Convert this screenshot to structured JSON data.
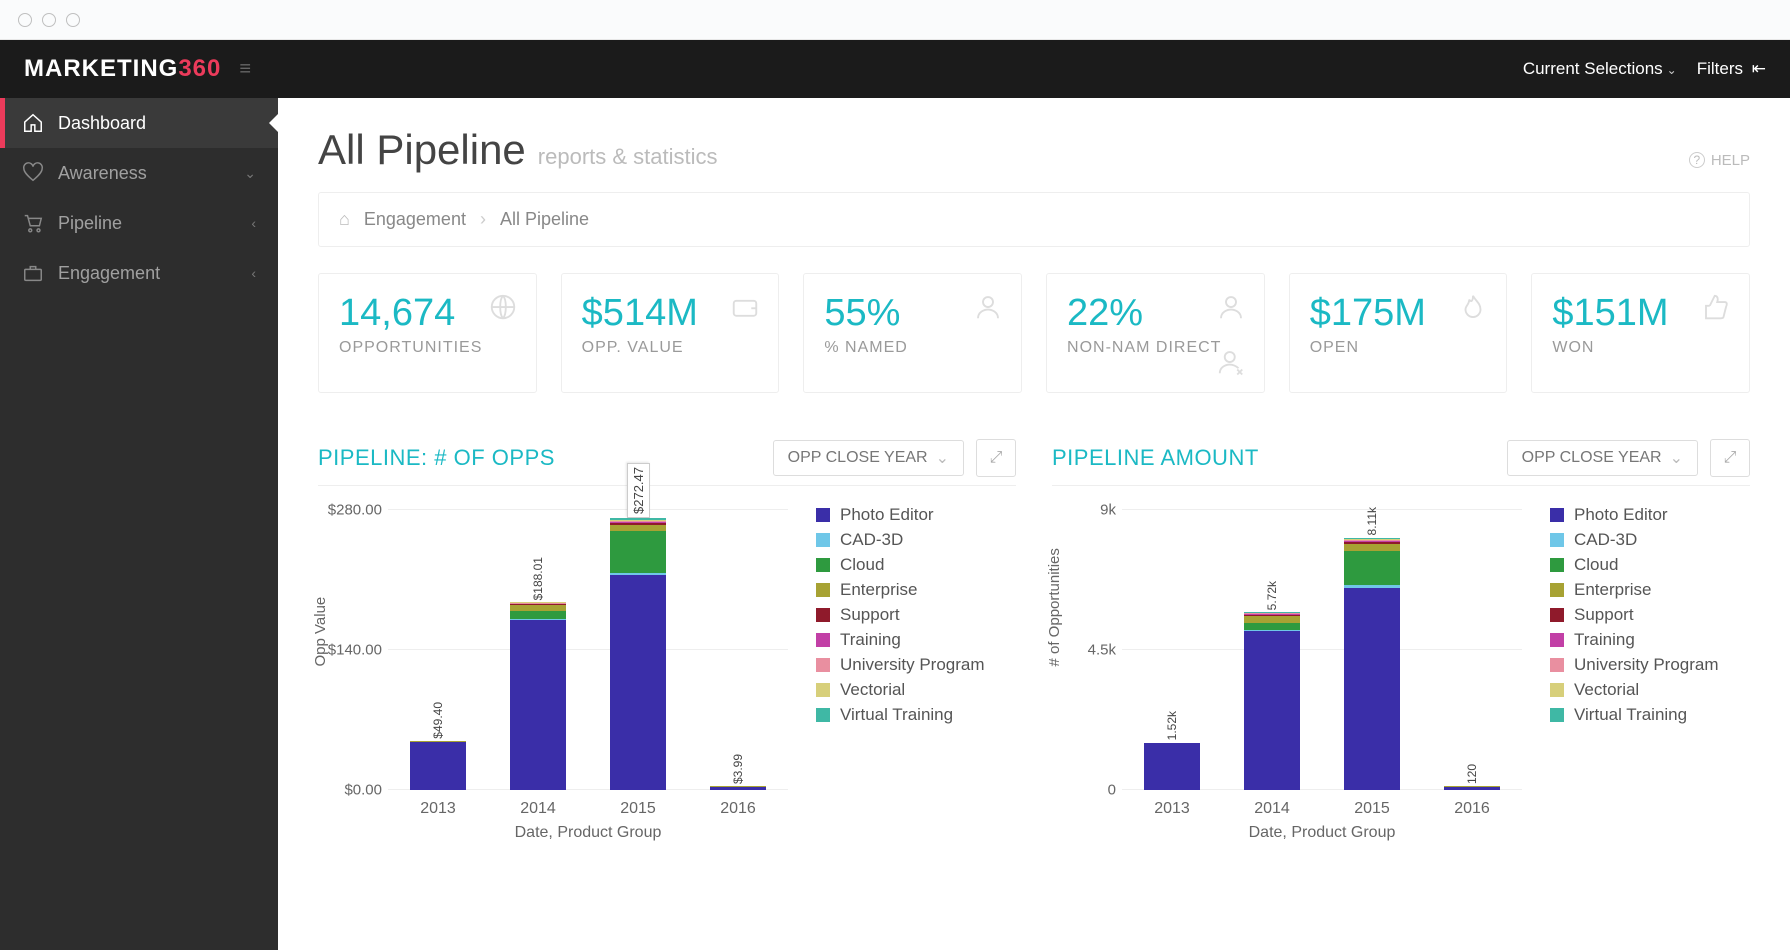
{
  "brand": {
    "part1": "MARKETING",
    "part2": "360"
  },
  "topbar": {
    "selections": "Current Selections",
    "filters": "Filters"
  },
  "sidebar": {
    "items": [
      {
        "label": "Dashboard",
        "icon": "home",
        "active": true
      },
      {
        "label": "Awareness",
        "icon": "heart",
        "expand": "down"
      },
      {
        "label": "Pipeline",
        "icon": "cart",
        "expand": "left"
      },
      {
        "label": "Engagement",
        "icon": "briefcase",
        "expand": "left"
      }
    ]
  },
  "page": {
    "title": "All Pipeline",
    "subtitle": "reports & statistics",
    "help": "HELP"
  },
  "breadcrumb": {
    "root": "Engagement",
    "leaf": "All Pipeline"
  },
  "kpi": [
    {
      "value": "14,674",
      "label": "OPPORTUNITIES",
      "icon": "globe"
    },
    {
      "value": "$514M",
      "label": "OPP. VALUE",
      "icon": "wallet"
    },
    {
      "value": "55%",
      "label": "% NAMED",
      "icon": "person"
    },
    {
      "value": "22%",
      "label": "NON-NAM DIRECT",
      "icon": "person-x"
    },
    {
      "value": "$175M",
      "label": "OPEN",
      "icon": "flame"
    },
    {
      "value": "$151M",
      "label": "WON",
      "icon": "thumb"
    }
  ],
  "dropdowns": {
    "closeYear": "OPP CLOSE YEAR"
  },
  "legend": [
    {
      "name": "Photo Editor",
      "color": "#3a2ea8"
    },
    {
      "name": "CAD-3D",
      "color": "#6fc7e8"
    },
    {
      "name": "Cloud",
      "color": "#2e9a3f"
    },
    {
      "name": "Enterprise",
      "color": "#a7a233"
    },
    {
      "name": "Support",
      "color": "#8f1a2b"
    },
    {
      "name": "Training",
      "color": "#c23fa6"
    },
    {
      "name": "University Program",
      "color": "#e98fa0"
    },
    {
      "name": "Vectorial",
      "color": "#d7cf7a"
    },
    {
      "name": "Virtual Training",
      "color": "#3fb8a5"
    }
  ],
  "chart_data": [
    {
      "type": "bar",
      "title": "PIPELINE: # OF OPPS",
      "ylabel": "Opp Value",
      "xlabel": "Date, Product Group",
      "y_ticks": [
        "$0.00",
        "$140.00",
        "$280.00"
      ],
      "ylim": [
        0,
        280
      ],
      "categories": [
        "2013",
        "2014",
        "2015",
        "2016"
      ],
      "totals": [
        49.4,
        188.01,
        272.47,
        3.99
      ],
      "total_labels": [
        "$49.40",
        "$188.01",
        "$272.47",
        "$3.99"
      ],
      "series": [
        {
          "name": "Photo Editor",
          "values": [
            48,
            170,
            215,
            3
          ]
        },
        {
          "name": "CAD-3D",
          "values": [
            0,
            1,
            2,
            0
          ]
        },
        {
          "name": "Cloud",
          "values": [
            0,
            8,
            42,
            0.5
          ]
        },
        {
          "name": "Enterprise",
          "values": [
            1,
            6,
            6,
            0.3
          ]
        },
        {
          "name": "Support",
          "values": [
            0,
            1,
            2,
            0
          ]
        },
        {
          "name": "Training",
          "values": [
            0,
            0.5,
            1,
            0
          ]
        },
        {
          "name": "University Program",
          "values": [
            0,
            0.5,
            1,
            0
          ]
        },
        {
          "name": "Vectorial",
          "values": [
            0.4,
            1,
            1.5,
            0.19
          ]
        },
        {
          "name": "Virtual Training",
          "values": [
            0,
            0,
            2,
            0
          ]
        }
      ],
      "highlight_index": 2
    },
    {
      "type": "bar",
      "title": "PIPELINE AMOUNT",
      "ylabel": "# of Opportunities",
      "xlabel": "Date, Product Group",
      "y_ticks": [
        "0",
        "4.5k",
        "9k"
      ],
      "ylim": [
        0,
        9000
      ],
      "categories": [
        "2013",
        "2014",
        "2015",
        "2016"
      ],
      "totals": [
        1520,
        5720,
        8110,
        120
      ],
      "total_labels": [
        "1.52k",
        "5.72k",
        "8.11k",
        "120"
      ],
      "series": [
        {
          "name": "Photo Editor",
          "values": [
            1500,
            5100,
            6500,
            90
          ]
        },
        {
          "name": "CAD-3D",
          "values": [
            0,
            40,
            80,
            0
          ]
        },
        {
          "name": "Cloud",
          "values": [
            0,
            230,
            1100,
            15
          ]
        },
        {
          "name": "Enterprise",
          "values": [
            10,
            220,
            220,
            10
          ]
        },
        {
          "name": "Support",
          "values": [
            0,
            40,
            70,
            0
          ]
        },
        {
          "name": "Training",
          "values": [
            0,
            20,
            40,
            0
          ]
        },
        {
          "name": "University Program",
          "values": [
            0,
            30,
            40,
            0
          ]
        },
        {
          "name": "Vectorial",
          "values": [
            10,
            20,
            30,
            5
          ]
        },
        {
          "name": "Virtual Training",
          "values": [
            0,
            20,
            30,
            0
          ]
        }
      ],
      "highlight_index": -1
    }
  ]
}
